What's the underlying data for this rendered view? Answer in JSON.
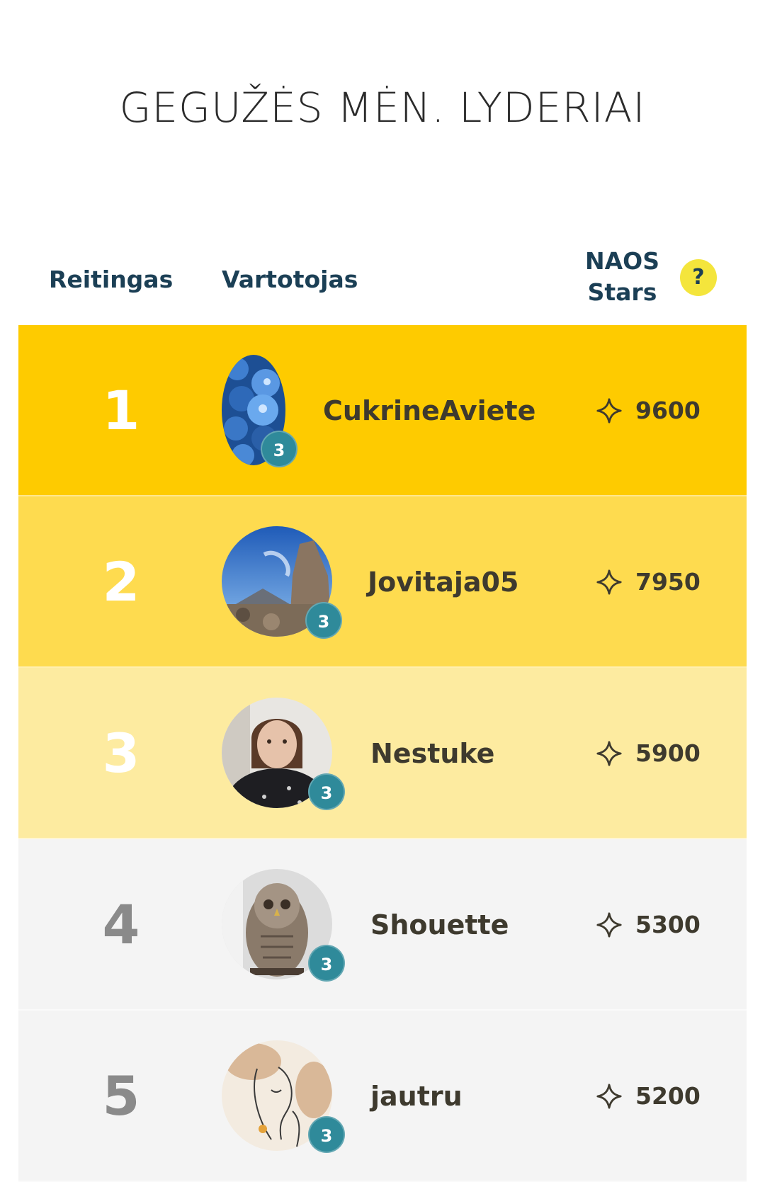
{
  "page": {
    "title": "GEGUŽĖS MĖN. LYDERIAI"
  },
  "header": {
    "rank_label": "Reitingas",
    "user_label": "Vartotojas",
    "stars_line1": "NAOS",
    "stars_line2": "Stars",
    "help_label": "?"
  },
  "colors": {
    "row1": "#fecb00",
    "row2": "#fedb4f",
    "row3": "#fdeba0",
    "row_plain": "#f4f4f4",
    "badge": "#2f8a9a",
    "help": "#f4e53c",
    "header_text": "#1b3f55"
  },
  "leaders": [
    {
      "rank": "1",
      "username": "CukrineAviete",
      "level": "3",
      "stars": "9600",
      "avatar_icon": "blue-raspberry-avatar"
    },
    {
      "rank": "2",
      "username": "Jovitaja05",
      "level": "3",
      "stars": "7950",
      "avatar_icon": "mountain-sky-avatar"
    },
    {
      "rank": "3",
      "username": "Nestuke",
      "level": "3",
      "stars": "5900",
      "avatar_icon": "woman-portrait-avatar"
    },
    {
      "rank": "4",
      "username": "Shouette",
      "level": "3",
      "stars": "5300",
      "avatar_icon": "owl-avatar"
    },
    {
      "rank": "5",
      "username": "jautru",
      "level": "3",
      "stars": "5200",
      "avatar_icon": "line-art-woman-avatar"
    }
  ]
}
